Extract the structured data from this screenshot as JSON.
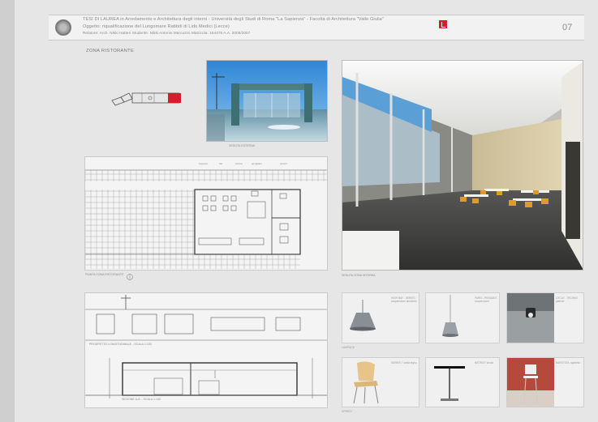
{
  "header": {
    "line1": "TESI DI LAUREA  in Arredamento e Architettura degli interni - Università degli Studi di Roma \"La Sapienza\" - Facoltà di Architettura \"Valle Giulia\"",
    "line2": "Oggetto: riqualificazione del Lungomare Rabbiti di Lido Medici (Lecce)",
    "line3": "Relatore: Arch. Nikki Hatteri        Studente: Nikki Antonio Marcuzzo   Matricola: 164475   A.A. 2006/2007",
    "page_number": "07"
  },
  "section_title": "ZONA RISTORANTE",
  "captions": {
    "render_small": "VEDUTA ESTERNA",
    "plan": "PIANTA ZONA RISTORANTE",
    "render_large": "VEDUTA ZONA INTERNA",
    "elevation": "PROSPETTO LONGITUDINALE - SCALA 1:100",
    "section": "SEZIONE A-A' - SCALA 1:100",
    "lamps": "LAMPADE",
    "chairs": "ARREDI"
  },
  "plan_labels": [
    "ingresso",
    "bar",
    "cucina",
    "spogliatoi",
    "servizi"
  ],
  "products": [
    {
      "name": "product-pendant-lamp-1",
      "text": "HIGH BAY - SERIES sospensione alluminio"
    },
    {
      "name": "product-pendant-lamp-2",
      "text": "PARIS - PENDANT sospensione"
    },
    {
      "name": "product-ceiling-spot",
      "text": "CYCLE - TECHNO plafone"
    },
    {
      "name": "product-wooden-chair",
      "text": "SERIES 7 sedia legno"
    },
    {
      "name": "product-black-table",
      "text": "BISTROT tavolo"
    },
    {
      "name": "product-bar-stool",
      "text": "BARSTOOL sgabello"
    }
  ],
  "colors": {
    "accent": "#d21f2a",
    "sheet": "#e6e6e6",
    "panel": "#f4f4f4"
  }
}
